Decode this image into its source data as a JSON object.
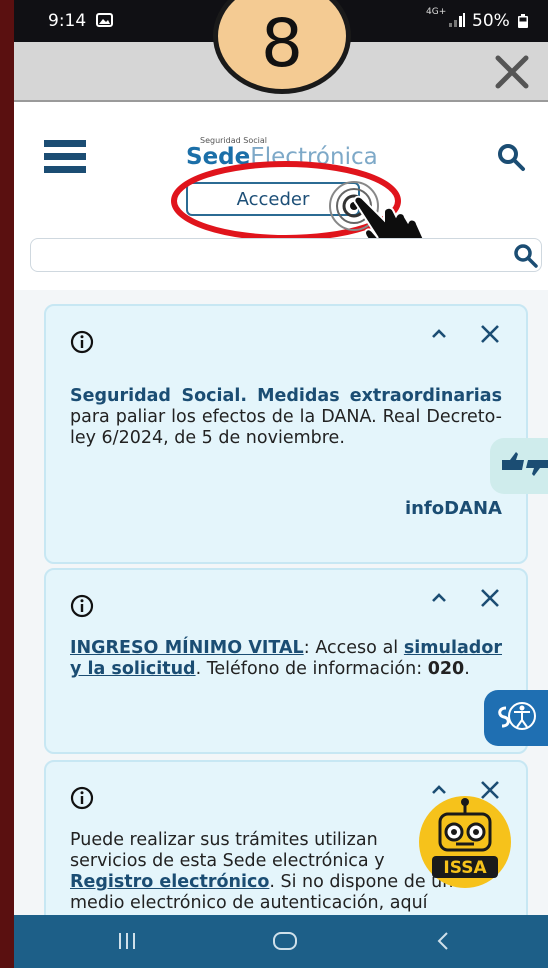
{
  "status_bar": {
    "time": "9:14",
    "network": "4G+",
    "battery": "50%"
  },
  "step_badge": {
    "number": "8"
  },
  "header": {
    "logo_small": "Seguridad Social",
    "logo_part1": "Sede",
    "logo_part2": "Electrónica",
    "login_button": "Acceder",
    "search_placeholder": ""
  },
  "notices": [
    {
      "strong1": "Seguridad Social.",
      "strong2": "Medidas",
      "strong3": "extraordinarias",
      "text": " para paliar los efectos de la DANA. Real Decreto-ley 6/2024, de 5 de noviembre.",
      "link": "infoDANA"
    },
    {
      "link1": "INGRESO MÍNIMO VITAL",
      "text1": ": Acceso al ",
      "link2": "simulador y la solicitud",
      "text2": ". Teléfono de información: ",
      "phone": "020",
      "text3": "."
    },
    {
      "text1": "Puede realizar sus trámites utilizan",
      "text2": "servicios de esta Sede electrónica y",
      "link": "Registro electrónico",
      "text3": ". Si no dispone de un",
      "text4": "medio electrónico de autenticación, aquí"
    }
  ],
  "widgets": {
    "bot_label": "ISSA"
  },
  "colors": {
    "brand": "#1b6fa8",
    "highlight": "#e0141c",
    "panel": "#e4f5fb",
    "navbar": "#1d5f88"
  }
}
